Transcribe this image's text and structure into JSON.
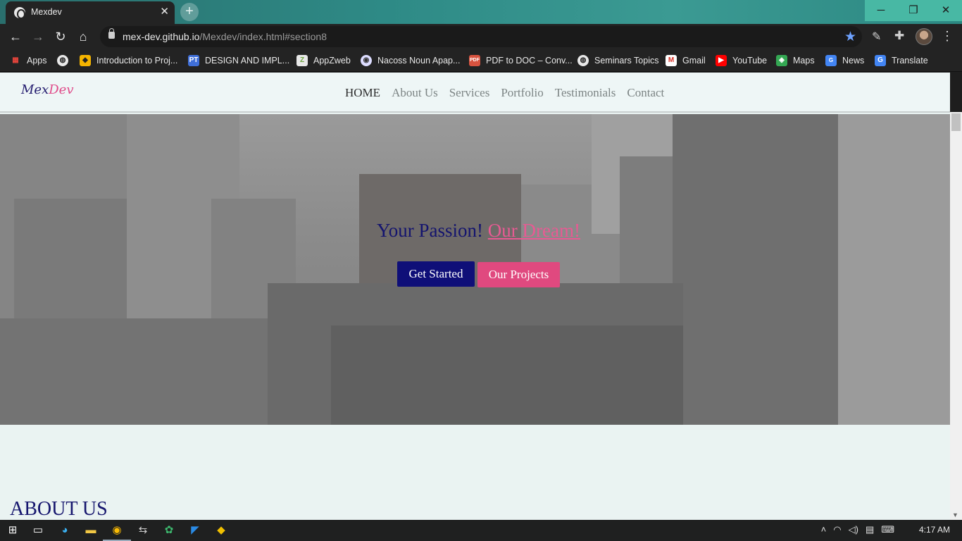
{
  "browser": {
    "tab_title": "Mexdev",
    "url_host": "mex-dev.github.io",
    "url_path": "/Mexdev/index.html#section8",
    "bookmarks": [
      {
        "label": "Apps",
        "icon": "apps-grid-icon",
        "color": "#e8453c"
      },
      {
        "label": "",
        "icon": "globe-icon",
        "color": "#cccccc"
      },
      {
        "label": "Introduction to Proj...",
        "icon": "shield-icon",
        "color": "#f4b400"
      },
      {
        "label": "DESIGN AND IMPL...",
        "icon": "pt-icon",
        "color": "#3f6fd8"
      },
      {
        "label": "AppZweb",
        "icon": "z-icon",
        "color": "#6ba33e"
      },
      {
        "label": "Nacoss Noun Apap...",
        "icon": "nacoss-icon",
        "color": "#8a8aff"
      },
      {
        "label": "PDF to DOC – Conv...",
        "icon": "pdf-icon",
        "color": "#d8533f"
      },
      {
        "label": "Seminars Topics",
        "icon": "globe-icon",
        "color": "#cccccc"
      },
      {
        "label": "Gmail",
        "icon": "gmail-icon",
        "color": "#d93025"
      },
      {
        "label": "YouTube",
        "icon": "youtube-icon",
        "color": "#ff0000"
      },
      {
        "label": "Maps",
        "icon": "maps-icon",
        "color": "#34a853"
      },
      {
        "label": "News",
        "icon": "news-icon",
        "color": "#4285f4"
      },
      {
        "label": "Translate",
        "icon": "translate-icon",
        "color": "#4285f4"
      }
    ]
  },
  "site": {
    "logo_part1": "Mex",
    "logo_part2": "Dev",
    "nav": [
      "HOME",
      "About Us",
      "Services",
      "Portfolio",
      "Testimonials",
      "Contact"
    ],
    "hero_text1": "Your Passion!",
    "hero_text2": "Our Dream!",
    "btn_start": "Get Started",
    "btn_projects": "Our Projects",
    "about_title": "ABOUT US"
  },
  "taskbar": {
    "clock": "4:17 AM"
  },
  "colors": {
    "brand_navy": "#14146e",
    "brand_pink": "#e0497f"
  }
}
